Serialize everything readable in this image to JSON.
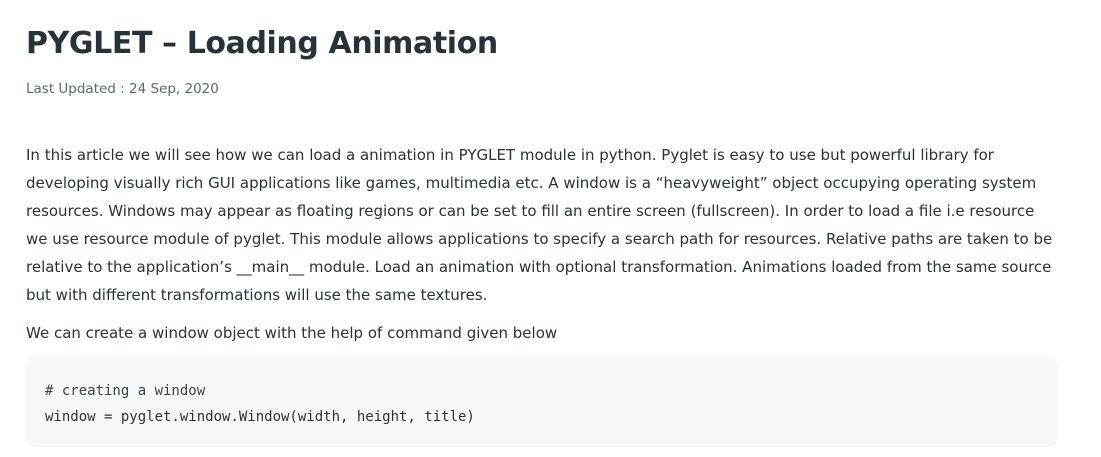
{
  "article": {
    "title": "PYGLET – Loading Animation",
    "last_updated": "Last Updated : 24 Sep, 2020",
    "paragraph_1": "In this article we will see how we can load a animation in PYGLET module in python. Pyglet is easy to use but powerful library for developing visually rich GUI applications like games, multimedia etc. A window is a “heavyweight” object occupying operating system resources. Windows may appear as floating regions or can be set to fill an entire screen (fullscreen). In order to load a file i.e resource we use resource module of pyglet. This module allows applications to specify a search path for resources. Relative paths are taken to be relative to the application’s __main__ module. Load an animation with optional transformation. Animations loaded from the same source but with different transformations will use the same textures.",
    "paragraph_2": "We can create a window object with the help of command given below",
    "code": {
      "lines": [
        "# creating a window",
        "window = pyglet.window.Window(width, height, title)"
      ]
    }
  }
}
